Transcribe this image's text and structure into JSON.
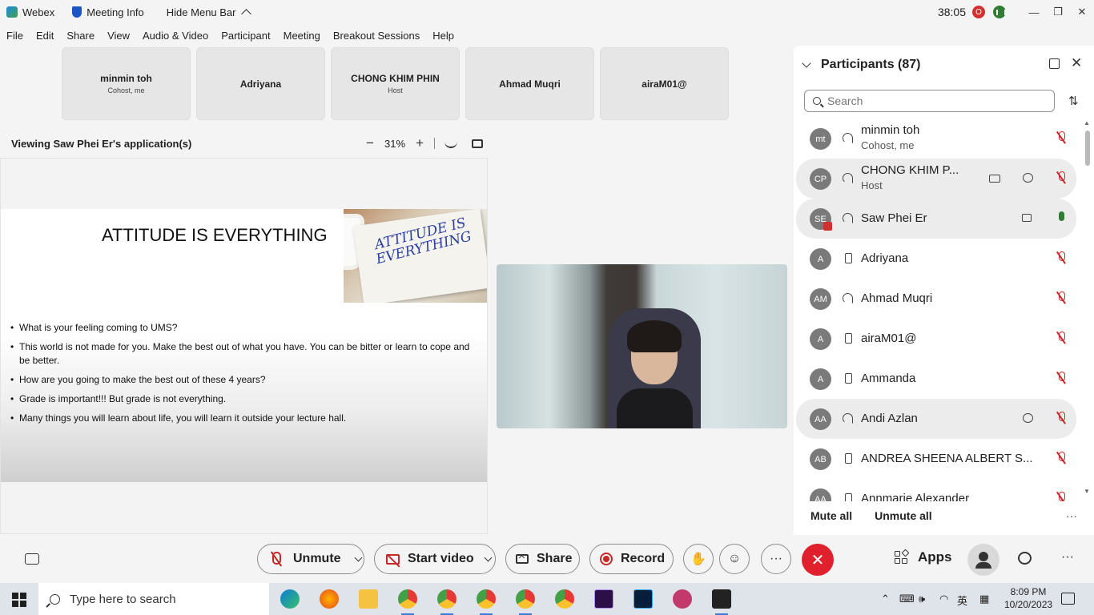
{
  "titlebar": {
    "app": "Webex",
    "meeting_info": "Meeting Info",
    "hide_menu": "Hide Menu Bar",
    "timer": "38:05",
    "rec_badge": "O"
  },
  "menu": [
    "File",
    "Edit",
    "Share",
    "View",
    "Audio & Video",
    "Participant",
    "Meeting",
    "Breakout Sessions",
    "Help"
  ],
  "strip": [
    {
      "name": "minmin toh",
      "sub": "Cohost, me"
    },
    {
      "name": "Adriyana",
      "sub": ""
    },
    {
      "name": "CHONG KHIM PHIN",
      "sub": "Host"
    },
    {
      "name": "Ahmad Muqri",
      "sub": ""
    },
    {
      "name": "airaM01@",
      "sub": ""
    }
  ],
  "viewing": {
    "title": "Viewing Saw Phei Er's application(s)",
    "zoom": "31%",
    "zoom_out": "−",
    "zoom_in": "+"
  },
  "slide": {
    "title": "ATTITUDE IS EVERYTHING",
    "image_text": "ATTITUDE IS EVERYTHING",
    "bullets": [
      "What is your feeling coming to UMS?",
      "This world is not made for you. Make the best out of what you have. You can be bitter or learn to cope and be better.",
      "How are you going to make the best out of these 4 years?",
      "Grade is important!!! But grade is not everything.",
      "Many things you will learn about life, you will learn it outside your lecture hall."
    ]
  },
  "panel": {
    "title": "Participants (87)",
    "search_placeholder": "Search",
    "mute_all": "Mute all",
    "unmute_all": "Unmute all",
    "more": "···",
    "participants": [
      {
        "initials": "mt",
        "name": "minmin toh",
        "role": "Cohost, me",
        "device": "headset",
        "mic": "muted",
        "highlight": false
      },
      {
        "initials": "CP",
        "name": "CHONG KHIM P...",
        "role": "Host",
        "device": "headset",
        "mic": "muted",
        "highlight": true
      },
      {
        "initials": "SE",
        "name": "Saw Phei Er",
        "role": "",
        "device": "headset",
        "mic": "on",
        "highlight": true
      },
      {
        "initials": "A",
        "name": "Adriyana",
        "role": "",
        "device": "phone",
        "mic": "muted",
        "highlight": false
      },
      {
        "initials": "AM",
        "name": "Ahmad Muqri",
        "role": "",
        "device": "headset",
        "mic": "muted",
        "highlight": false
      },
      {
        "initials": "A",
        "name": "airaM01@",
        "role": "",
        "device": "phone",
        "mic": "muted",
        "highlight": false
      },
      {
        "initials": "A",
        "name": "Ammanda",
        "role": "",
        "device": "phone",
        "mic": "muted",
        "highlight": false
      },
      {
        "initials": "AA",
        "name": "Andi Azlan",
        "role": "",
        "device": "headset",
        "mic": "muted",
        "highlight": true
      },
      {
        "initials": "AB",
        "name": "ANDREA SHEENA ALBERT S...",
        "role": "",
        "device": "phone",
        "mic": "muted",
        "highlight": false
      },
      {
        "initials": "AA",
        "name": "Annmarie Alexander",
        "role": "",
        "device": "phone",
        "mic": "muted",
        "highlight": false
      }
    ]
  },
  "controls": {
    "unmute": "Unmute",
    "start_video": "Start video",
    "share": "Share",
    "record": "Record",
    "apps": "Apps",
    "end": "✕",
    "more": "···"
  },
  "taskbar": {
    "search_placeholder": "Type here to search",
    "lang": "英",
    "time": "8:09 PM",
    "date": "10/20/2023"
  },
  "colors": {
    "end_red": "#e0202c",
    "muted_red": "#c62828",
    "mic_green": "#2e7d32"
  }
}
